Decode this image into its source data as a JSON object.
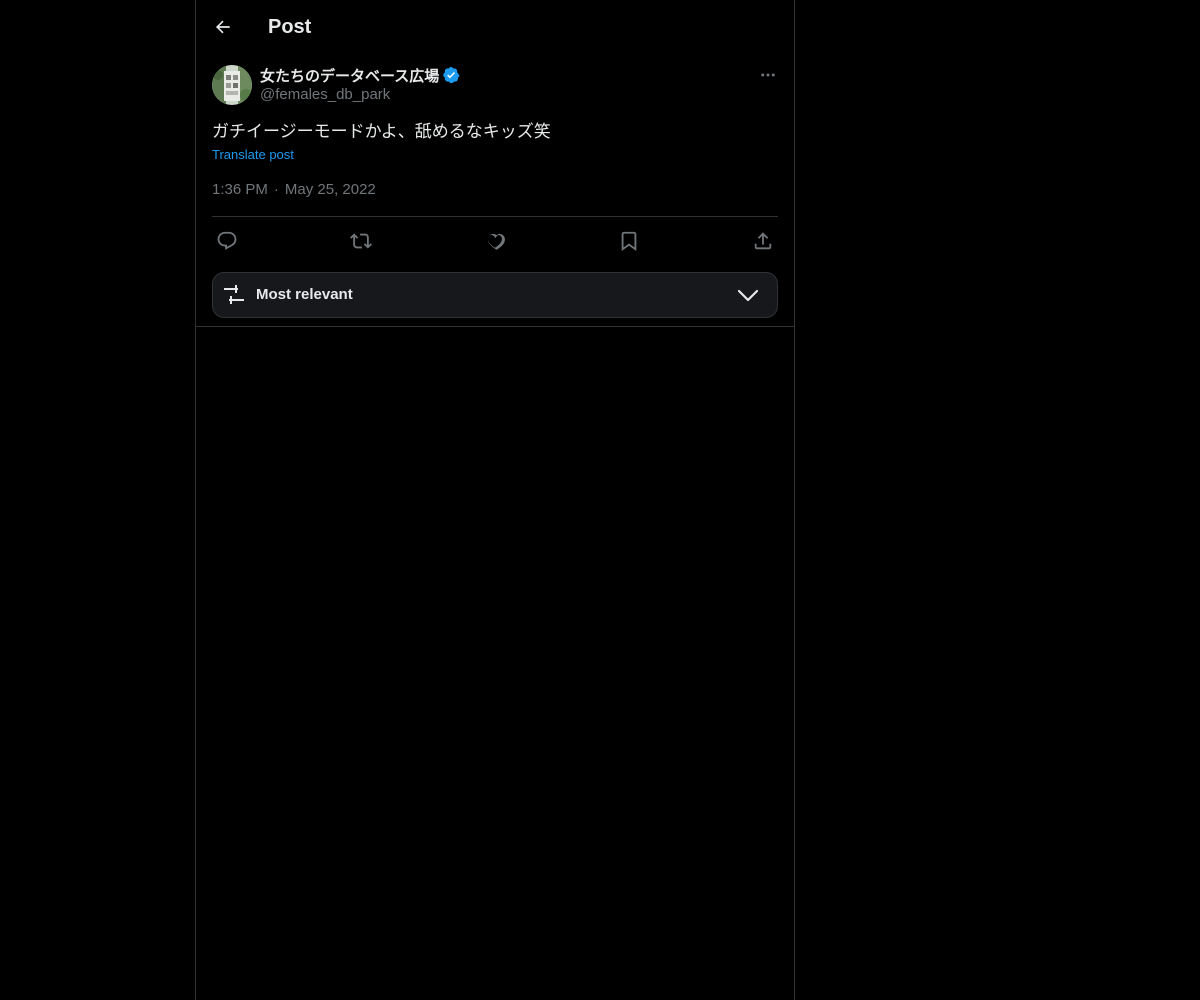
{
  "header": {
    "title": "Post",
    "back_icon": "arrow-left-icon"
  },
  "post": {
    "author": {
      "display_name": "女たちのデータベース広場",
      "handle": "@females_db_park",
      "verified": true,
      "verified_color": "#1d9bf0"
    },
    "text": "ガチイージーモードかよ、舐めるなキッズ笑",
    "translate_label": "Translate post",
    "time": "1:36 PM",
    "separator": "·",
    "date": "May 25, 2022"
  },
  "actions": [
    {
      "name": "reply",
      "icon": "reply-icon"
    },
    {
      "name": "repost",
      "icon": "repost-icon"
    },
    {
      "name": "like",
      "icon": "heart-icon"
    },
    {
      "name": "bookmark",
      "icon": "bookmark-icon"
    },
    {
      "name": "share",
      "icon": "share-icon"
    }
  ],
  "replies_sort": {
    "label": "Most relevant",
    "icon": "sliders-icon"
  },
  "colors": {
    "background": "#000000",
    "text": "#e7e9ea",
    "secondary_text": "#71767b",
    "accent": "#1d9bf0",
    "border": "#2f3336"
  }
}
